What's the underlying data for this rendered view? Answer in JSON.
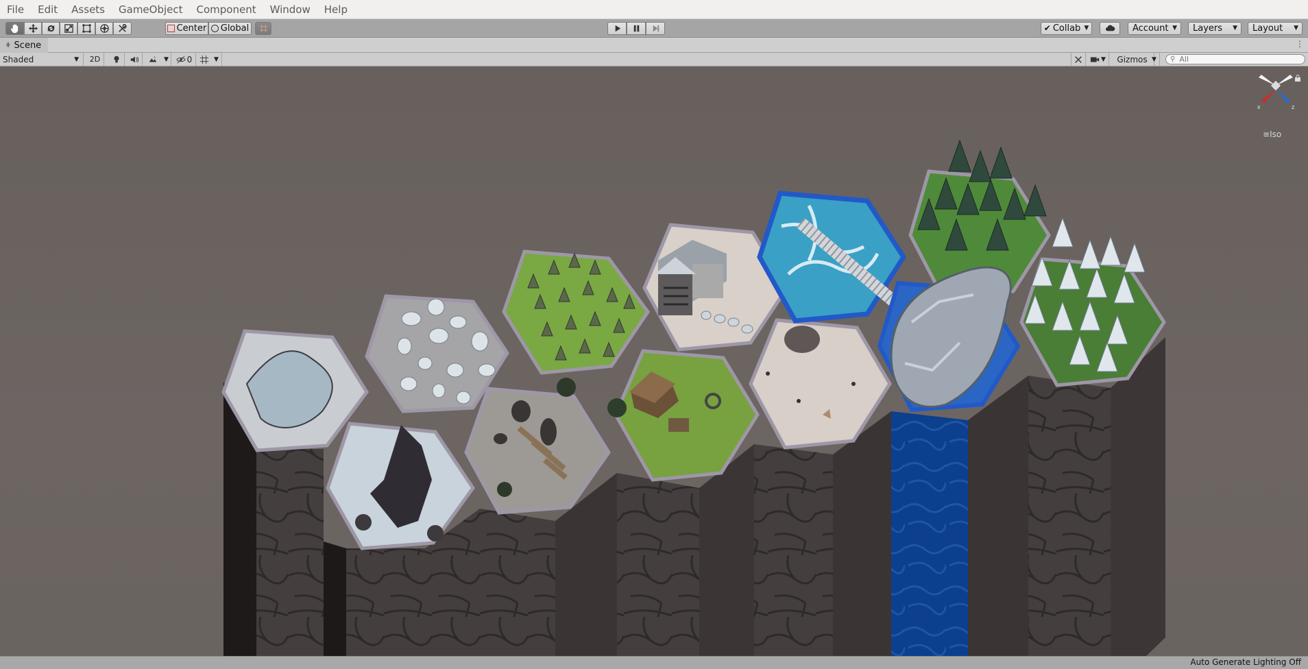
{
  "menu": [
    "File",
    "Edit",
    "Assets",
    "GameObject",
    "Component",
    "Window",
    "Help"
  ],
  "toolbar": {
    "tools": [
      "hand-tool",
      "move-tool",
      "rotate-tool",
      "scale-tool",
      "rect-tool",
      "transform-tool",
      "custom-editor-tool"
    ],
    "pivot_label": "Center",
    "space_label": "Global",
    "collab_label": "Collab",
    "account_label": "Account",
    "layers_label": "Layers",
    "layout_label": "Layout"
  },
  "scene_tab": {
    "title": "Scene"
  },
  "scene_toolbar": {
    "draw_mode": "Shaded",
    "mode_2d": "2D",
    "hidden_count": "0",
    "gizmos_label": "Gizmos",
    "search_placeholder": "All"
  },
  "gizmo": {
    "projection_label": "Iso",
    "x_label": "x",
    "z_label": "z"
  },
  "status": {
    "message": "Auto Generate Lighting Off"
  },
  "colors": {
    "menubar_bg": "#f2f0ee",
    "toolbar_bg": "#a5a5a5",
    "viewport_bg": "#6b6561",
    "grass": "#74a640",
    "water": "#3aa0c6",
    "waterfall": "#0b3d8a",
    "cliff": "#3f3a3a"
  }
}
